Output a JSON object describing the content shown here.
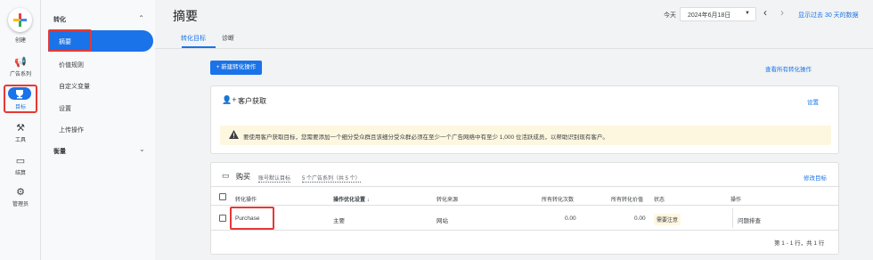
{
  "rail": {
    "create_label": "创建",
    "campaigns_label": "广告系列",
    "goals_label": "目标",
    "tools_label": "工具",
    "billing_label": "结算",
    "admin_label": "管理员"
  },
  "sidebar": {
    "section_conversions": "转化",
    "items": [
      "摘要",
      "价值规则",
      "自定义变量",
      "设置",
      "上传操作"
    ],
    "section_measurement": "衡量"
  },
  "header": {
    "title": "摘要",
    "today_label": "今天",
    "date_value": "2024年6月18日",
    "range_text": "显示过去 30 天的数据"
  },
  "tabs": [
    "转化目标",
    "诊断"
  ],
  "actions": {
    "new_conversion": "+ 新建转化操作",
    "view_all": "查看所有转化操作"
  },
  "acquisition_card": {
    "title": "客户获取",
    "settings_link": "设置",
    "warning": "要使用客户获取目标，您需要添加一个细分受众群且该细分受众群必须在至少一个广告网络中有至少 1,000 位活跃成员，以帮助识别现有客户。"
  },
  "purchase_card": {
    "title": "购买",
    "account_default": "账号默认目标",
    "campaigns_link": "5 个广告系列（共 5 个）",
    "edit_goal": "修改目标",
    "columns": [
      "转化操作",
      "操作优化设置 ↓",
      "转化来源",
      "所有转化次数",
      "所有转化价值",
      "状态",
      "操作"
    ],
    "rows": [
      {
        "action": "Purchase",
        "optimization": "主要",
        "source": "网站",
        "conversions": "0.00",
        "value": "0.00",
        "status": "需要注意",
        "op": "问题排查"
      }
    ],
    "pagination": "第 1 - 1 行，共 1 行"
  },
  "colors": {
    "accent": "#1a73e8",
    "highlight_border": "#e53935",
    "warning_bg": "#fef7e0"
  }
}
